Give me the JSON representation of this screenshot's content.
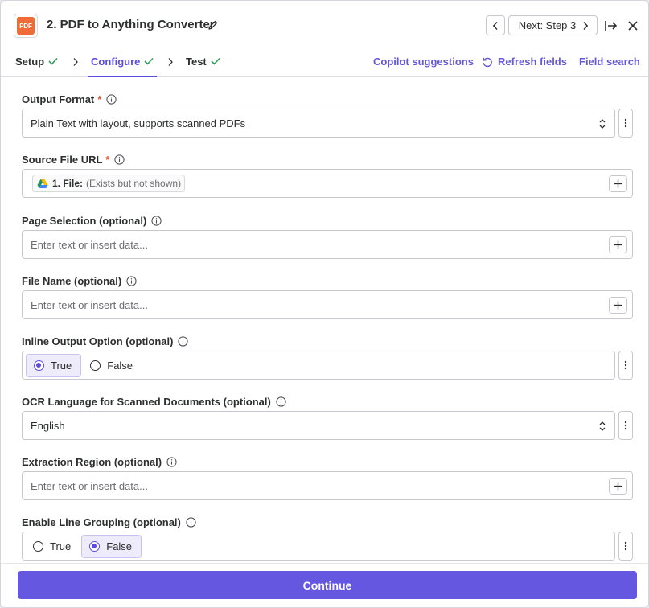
{
  "header": {
    "logo_text": "PDF",
    "title": "2. PDF to Anything Converter",
    "next_label": "Next: Step 3"
  },
  "tabs": [
    {
      "label": "Setup"
    },
    {
      "label": "Configure"
    },
    {
      "label": "Test"
    }
  ],
  "toolbar": {
    "copilot": "Copilot suggestions",
    "refresh": "Refresh fields",
    "field_search": "Field search"
  },
  "fields": {
    "output_format": {
      "label": "Output Format",
      "required": "*",
      "value": "Plain Text with layout, supports scanned PDFs"
    },
    "source_file_url": {
      "label": "Source File URL",
      "required": "*",
      "pill_name": "1. File:",
      "pill_value": "(Exists but not shown)"
    },
    "page_selection": {
      "label": "Page Selection (optional)",
      "placeholder": "Enter text or insert data..."
    },
    "file_name": {
      "label": "File Name (optional)",
      "placeholder": "Enter text or insert data..."
    },
    "inline_output": {
      "label": "Inline Output Option (optional)",
      "options": [
        "True",
        "False"
      ],
      "selected": "True"
    },
    "ocr_language": {
      "label": "OCR Language for Scanned Documents (optional)",
      "value": "English"
    },
    "extraction_region": {
      "label": "Extraction Region (optional)",
      "placeholder": "Enter text or insert data..."
    },
    "line_grouping": {
      "label": "Enable Line Grouping (optional)",
      "options": [
        "True",
        "False"
      ],
      "selected": "False"
    }
  },
  "footer": {
    "continue_label": "Continue"
  },
  "colors": {
    "accent": "#5b4cdc",
    "button": "#6557e0",
    "check": "#2e9e57",
    "required": "#e0542f",
    "logo": "#f06b38"
  }
}
